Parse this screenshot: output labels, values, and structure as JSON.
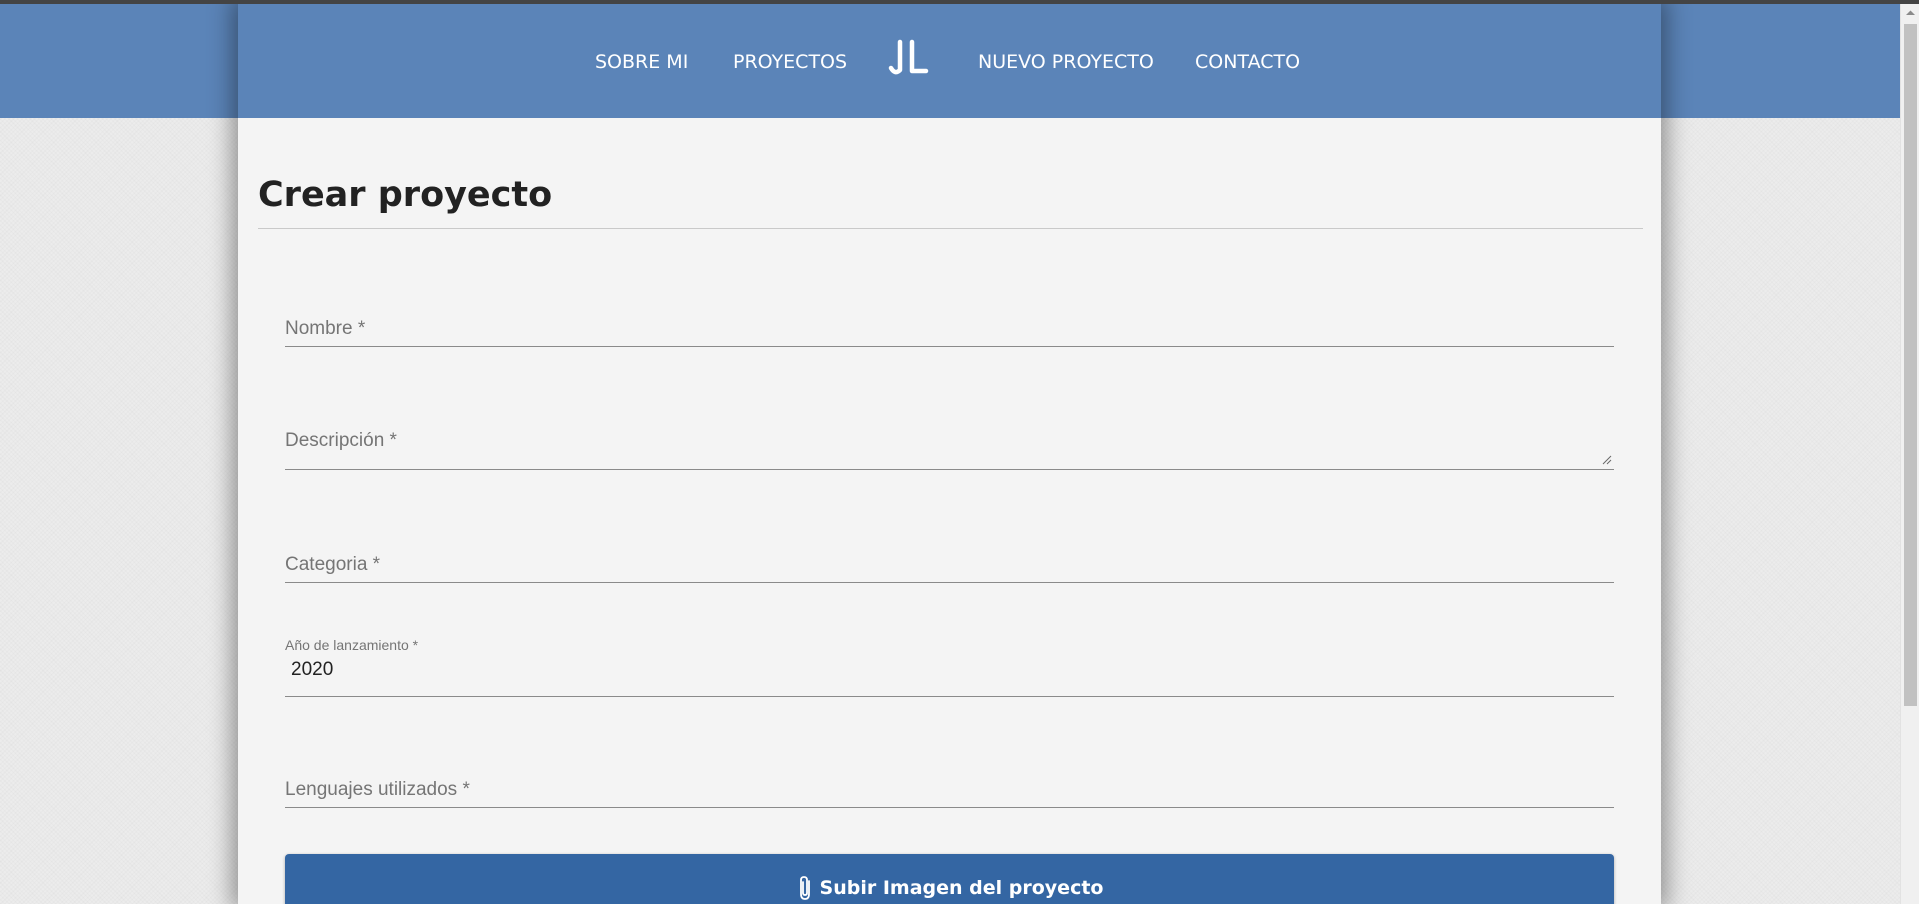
{
  "nav": {
    "items": [
      {
        "label": "SOBRE MI"
      },
      {
        "label": "PROYECTOS"
      },
      {
        "label": "NUEVO PROYECTO"
      },
      {
        "label": "CONTACTO"
      }
    ],
    "logo_text": "JL",
    "logo_icon": "jl-monogram-icon"
  },
  "page": {
    "title": "Crear proyecto"
  },
  "form": {
    "fields": [
      {
        "label": "Nombre *",
        "value": ""
      },
      {
        "label": "Descripción *",
        "value": ""
      },
      {
        "label": "Categoria *",
        "value": ""
      },
      {
        "label": "Año de lanzamiento *",
        "value": "2020"
      },
      {
        "label": "Lenguajes utilizados *",
        "value": ""
      }
    ],
    "upload": {
      "label": "Subir Imagen del proyecto",
      "icon": "paperclip-icon"
    }
  },
  "colors": {
    "header": "#5b84b8",
    "button": "#3466a3"
  }
}
